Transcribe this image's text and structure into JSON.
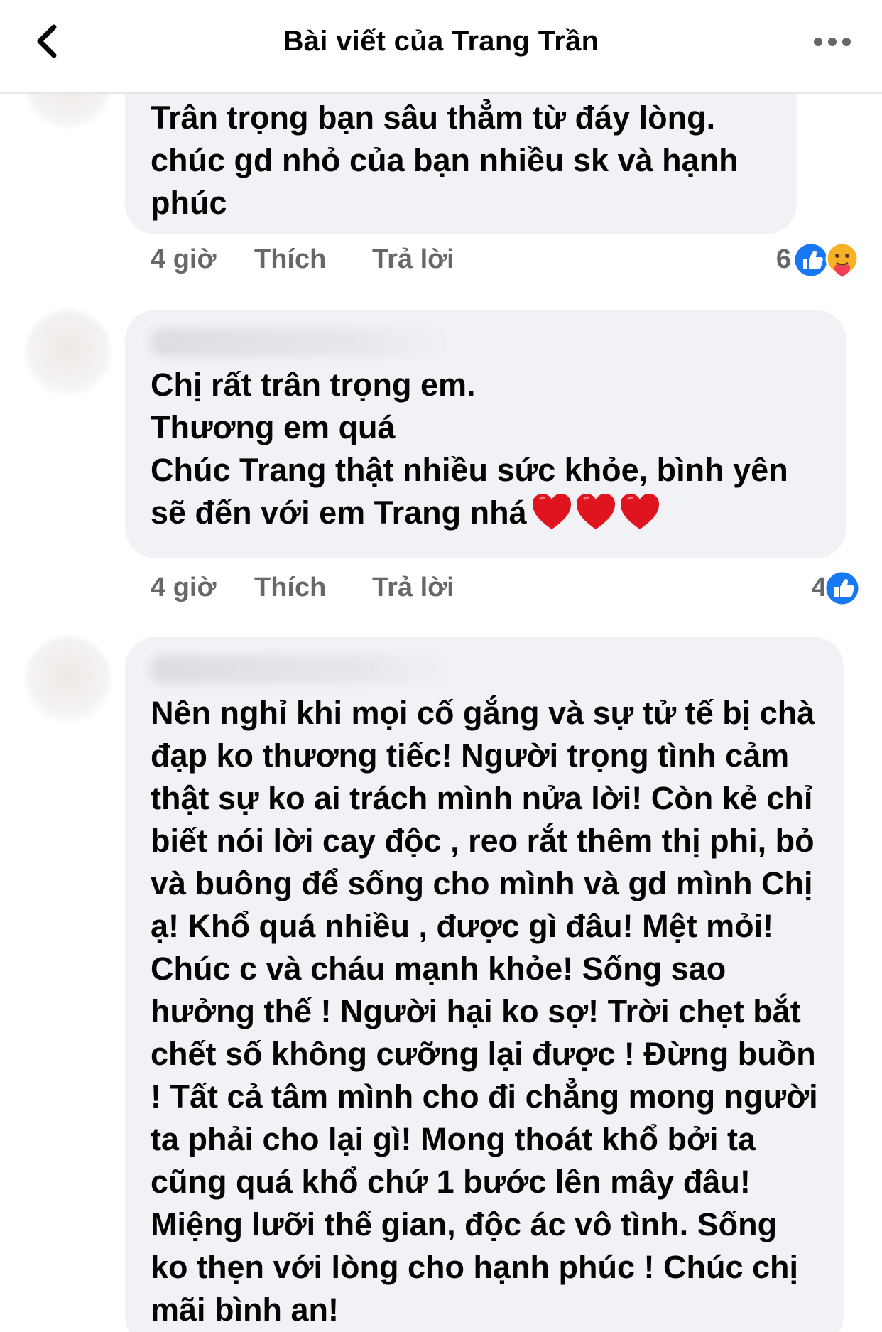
{
  "header": {
    "title": "Bài viết của Trang Trần"
  },
  "comments": [
    {
      "text": "Trân trọng bạn sâu thẳm từ đáy lòng.\nchúc gd nhỏ của bạn nhiều sk và hạnh phúc",
      "time": "4 giờ",
      "like_label": "Thích",
      "reply_label": "Trả lời",
      "reaction_count": "6",
      "reactions": [
        "like-icon",
        "care-icon"
      ]
    },
    {
      "text": "Chị rất trân trọng em.\nThương em quá\nChúc Trang thật nhiều sức khỏe, bình yên\nsẽ đến với em Trang nhá",
      "emoji": [
        "heart-icon",
        "heart-icon",
        "heart-icon"
      ],
      "time": "4 giờ",
      "like_label": "Thích",
      "reply_label": "Trả lời",
      "reaction_count": "4",
      "reactions": [
        "like-icon"
      ]
    },
    {
      "text": "Nên nghỉ khi mọi cố gắng và sự tử tế bị chà đạp ko thương tiếc! Người trọng tình cảm thật sự ko ai trách mình nửa lời! Còn kẻ chỉ biết nói lời cay độc , reo rắt thêm thị phi, bỏ và buông để sống cho mình và gd mình Chị ạ! Khổ quá nhiều , được gì đâu! Mệt mỏi! Chúc c và cháu mạnh khỏe! Sống sao hưởng thế ! Người hại ko sợ! Trời chẹt bắt chết số không cưỡng lại được ! Đừng buồn ! Tất cả tâm mình cho đi chẳng mong người ta phải cho lại gì! Mong thoát khổ bởi ta cũng quá khổ chứ 1 bước lên mây đâu! Miệng lưỡi thế gian, độc ác vô tình. Sống ko thẹn với lòng cho hạnh phúc ! Chúc chị mãi bình an!"
    }
  ],
  "colors": {
    "bubble": "#f0f2f5",
    "secondary_text": "#65676b",
    "like_blue": "#1877f2",
    "heart_red": "#e0141e"
  }
}
